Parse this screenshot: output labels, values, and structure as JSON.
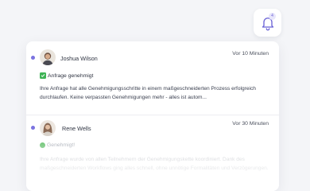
{
  "bell": {
    "icon": "bell-icon",
    "badge_count": "4"
  },
  "notifications": [
    {
      "sender": "Joshua Wilson",
      "time": "Vor 10 Minuten",
      "status": "Anfrage genehmigt",
      "status_icon": "check-square-icon",
      "message": "Ihre Anfrage hat alle Genehmigungsschritte in einem maßgeschneiderten Prozess erfolgreich durchlaufen. Keine verpassten Genehmigungen mehr - alles ist autom..."
    },
    {
      "sender": "Rene Wells",
      "time": "Vor 30 Minuten",
      "status": "Genehmigt!",
      "status_icon": "green-circle-icon",
      "message": "Ihre Anfrage wurde von allen Teilnehmern der Genehmigungskette koordiniert. Dank des maßgeschneiderten Workflows ging alles schnell, ohne unnötige Formalitäten und Verzögerungen."
    }
  ],
  "colors": {
    "accent": "#7b73e0",
    "success": "#3fb356",
    "background": "#f4f5f8"
  }
}
